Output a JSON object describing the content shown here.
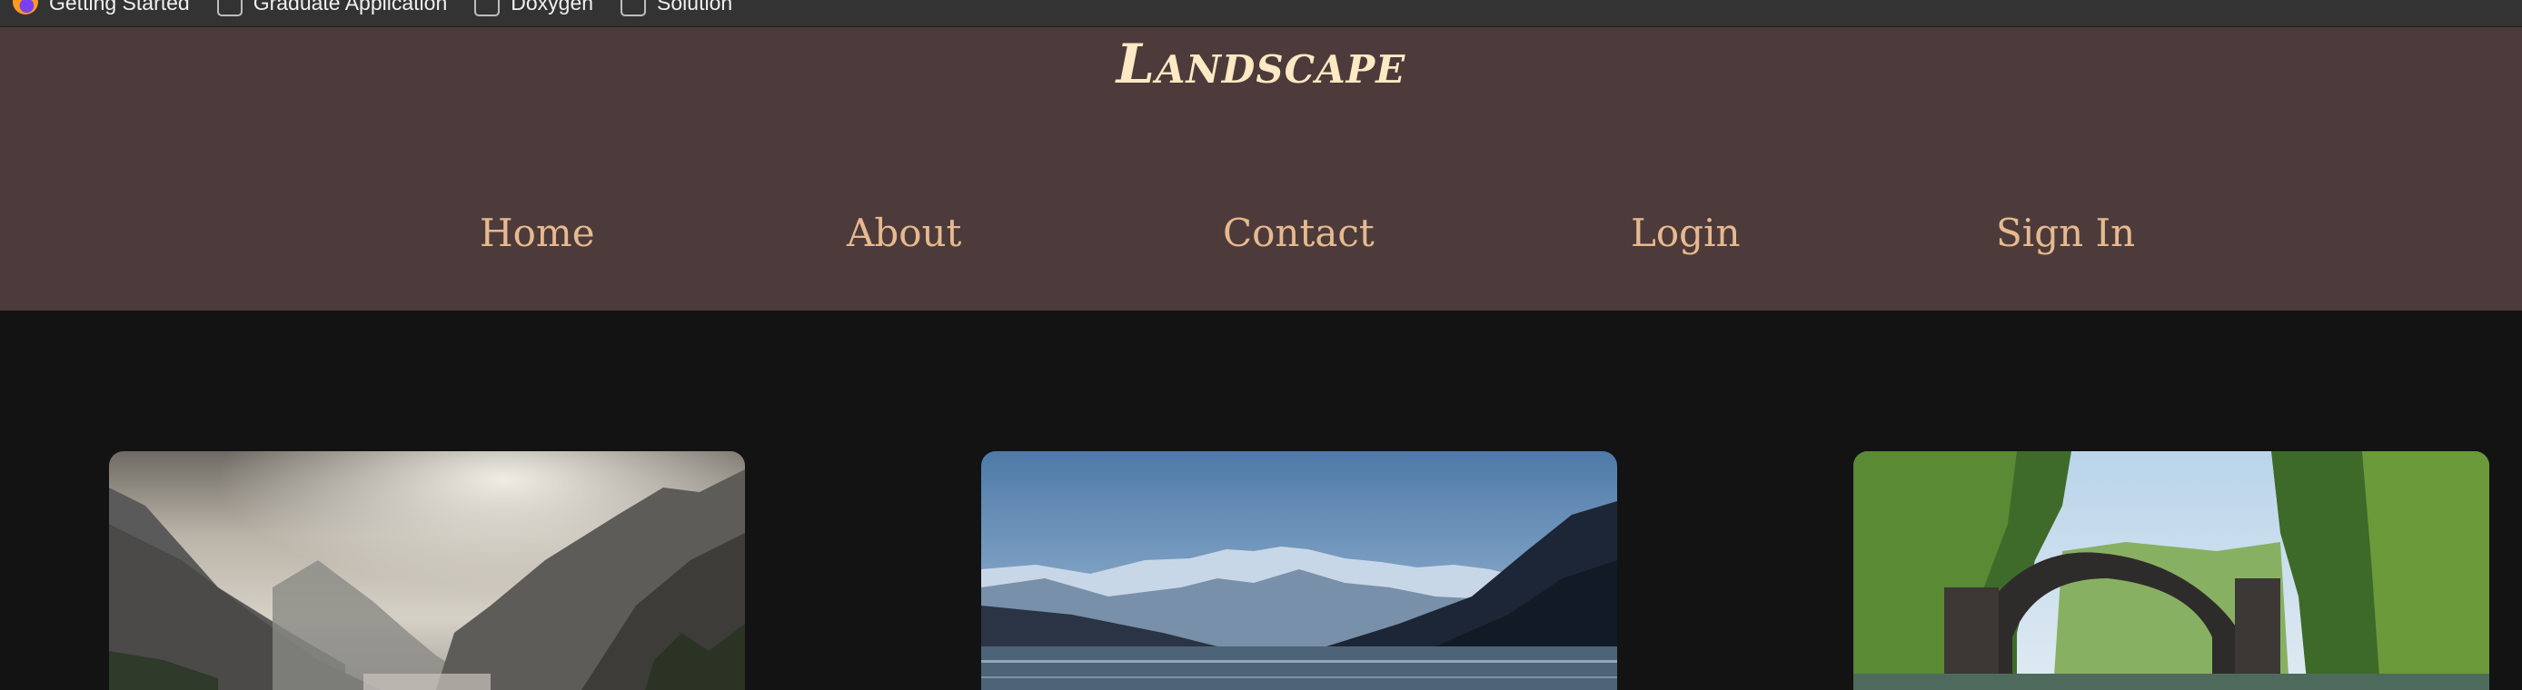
{
  "bookmarks": [
    {
      "label": "Getting Started",
      "icon": "firefox-icon"
    },
    {
      "label": "Graduate Application",
      "icon": "folder-icon"
    },
    {
      "label": "Doxygen",
      "icon": "folder-icon"
    },
    {
      "label": "Solution",
      "icon": "folder-icon"
    }
  ],
  "header": {
    "title": "Landscape"
  },
  "nav": {
    "home": "Home",
    "about": "About",
    "contact": "Contact",
    "login": "Login",
    "signin": "Sign In"
  },
  "cards": [
    {
      "subject": "mountain-valley-photo"
    },
    {
      "subject": "mountain-lake-photo"
    },
    {
      "subject": "stone-arch-bridge-photo"
    }
  ],
  "colors": {
    "header_bg": "#4d3b3b",
    "page_bg": "#131313",
    "title": "#fde9c4",
    "nav_link": "#e6b98f"
  }
}
